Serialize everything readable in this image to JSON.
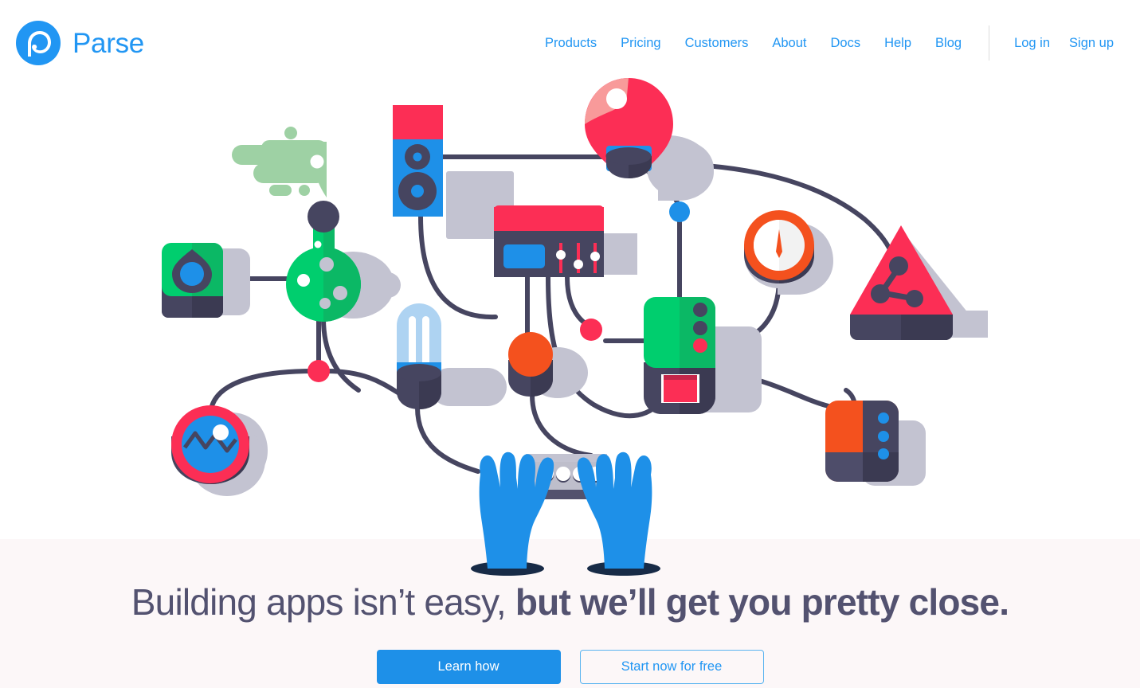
{
  "brand": {
    "name": "Parse",
    "logo_icon": "parse-logo-icon",
    "logo_color": "#2196F3"
  },
  "nav": {
    "items": [
      {
        "label": "Products"
      },
      {
        "label": "Pricing"
      },
      {
        "label": "Customers"
      },
      {
        "label": "About"
      },
      {
        "label": "Docs"
      },
      {
        "label": "Help"
      },
      {
        "label": "Blog"
      }
    ],
    "auth": [
      {
        "label": "Log in"
      },
      {
        "label": "Sign up"
      }
    ],
    "link_color": "#2196F3",
    "divider_color": "#dcdcdc"
  },
  "hero": {
    "headline_light": "Building apps isn’t easy,",
    "headline_bold": "but we’ll get you pretty close.",
    "headline_color": "#535270",
    "band_color": "#FCF7F8",
    "primary_cta": "Learn how",
    "secondary_cta": "Start now for free",
    "primary_bg": "#1E90E8",
    "secondary_border": "#5AB4F0",
    "illustration_name": "connected-devices-illustration"
  },
  "palette": {
    "blue": "#1E90E8",
    "red": "#FC2E55",
    "green": "#00CE6E",
    "orange": "#F4511E",
    "dark": "#464560",
    "gray": "#C3C3D1",
    "light_green": "#9ED1A4",
    "light_blue": "#AED3F2",
    "pale_red": "#F89A9A"
  }
}
